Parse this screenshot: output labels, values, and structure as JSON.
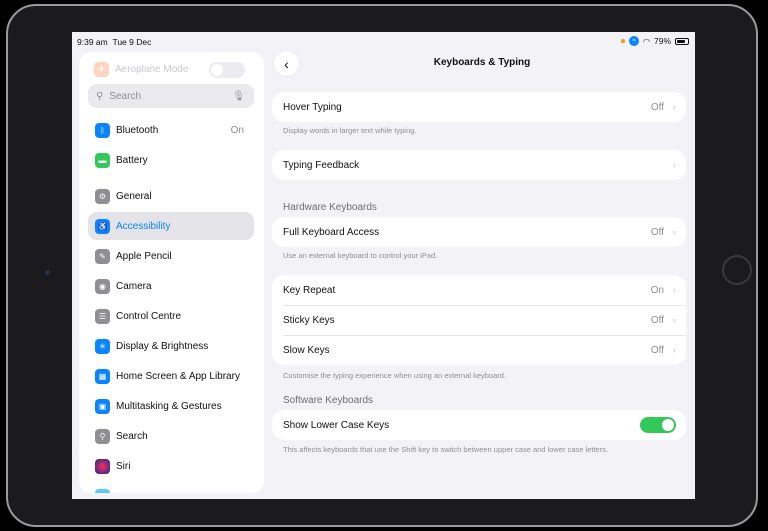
{
  "status": {
    "time": "9:39 am",
    "date": "Tue 9 Dec",
    "battery": "79%",
    "battery_level": 0.79
  },
  "sidebar": {
    "top_item": {
      "label": "Aeroplane Mode",
      "icon": "airplane-icon",
      "color": "#ff9500"
    },
    "search_placeholder": "Search",
    "items": [
      {
        "label": "Bluetooth",
        "value": "On",
        "icon": "bluetooth-icon",
        "color": "#0a84ff"
      },
      {
        "label": "Battery",
        "value": "",
        "icon": "battery-icon",
        "color": "#34c759"
      },
      {
        "label": "General",
        "value": "",
        "icon": "gear-icon",
        "color": "#8e8e93"
      },
      {
        "label": "Accessibility",
        "value": "",
        "icon": "accessibility-icon",
        "color": "#0a84ff",
        "selected": true
      },
      {
        "label": "Apple Pencil",
        "value": "",
        "icon": "pencil-icon",
        "color": "#8e8e93"
      },
      {
        "label": "Camera",
        "value": "",
        "icon": "camera-icon",
        "color": "#8e8e93"
      },
      {
        "label": "Control Centre",
        "value": "",
        "icon": "control-centre-icon",
        "color": "#8e8e93"
      },
      {
        "label": "Display & Brightness",
        "value": "",
        "icon": "sun-icon",
        "color": "#0a84ff"
      },
      {
        "label": "Home Screen & App Library",
        "value": "",
        "icon": "home-screen-icon",
        "color": "#0a84ff"
      },
      {
        "label": "Multitasking & Gestures",
        "value": "",
        "icon": "multitasking-icon",
        "color": "#0a84ff"
      },
      {
        "label": "Search",
        "value": "",
        "icon": "search-icon",
        "color": "#8e8e93"
      },
      {
        "label": "Siri",
        "value": "",
        "icon": "siri-icon",
        "color": "#5e2a84"
      }
    ]
  },
  "main": {
    "title": "Keyboards & Typing",
    "hover_typing": {
      "label": "Hover Typing",
      "value": "Off",
      "footnote": "Display words in larger text while typing."
    },
    "typing_feedback": {
      "label": "Typing Feedback"
    },
    "hardware_header": "Hardware Keyboards",
    "full_keyboard_access": {
      "label": "Full Keyboard Access",
      "value": "Off",
      "footnote": "Use an external keyboard to control your iPad."
    },
    "key_repeat": {
      "label": "Key Repeat",
      "value": "On"
    },
    "sticky_keys": {
      "label": "Sticky Keys",
      "value": "Off"
    },
    "slow_keys": {
      "label": "Slow Keys",
      "value": "Off"
    },
    "hardware_footnote": "Customise the typing experience when using an external keyboard.",
    "software_header": "Software Keyboards",
    "show_lower_case": {
      "label": "Show Lower Case Keys",
      "on": true,
      "footnote": "This affects keyboards that use the Shift key to switch between upper case and lower case letters."
    }
  }
}
